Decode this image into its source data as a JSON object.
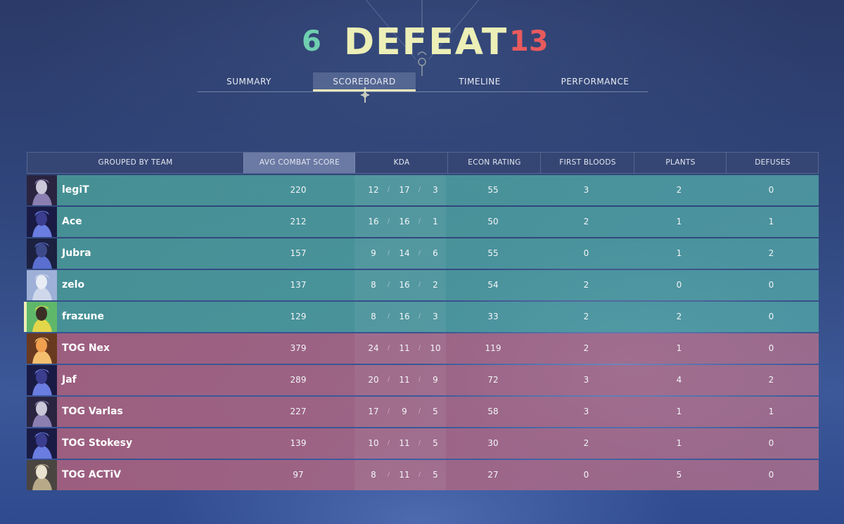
{
  "header": {
    "team_score": "6",
    "result": "DEFEAT",
    "enemy_score": "13",
    "team_color": "#6fcfb0",
    "enemy_color": "#e85a5e",
    "result_color": "#ecefb6"
  },
  "tabs": [
    {
      "label": "SUMMARY"
    },
    {
      "label": "SCOREBOARD",
      "active": true
    },
    {
      "label": "TIMELINE"
    },
    {
      "label": "PERFORMANCE"
    }
  ],
  "table": {
    "columns": [
      "GROUPED BY TEAM",
      "AVG COMBAT SCORE",
      "KDA",
      "ECON RATING",
      "FIRST BLOODS",
      "PLANTS",
      "DEFUSES"
    ],
    "sorted_column": "AVG COMBAT SCORE",
    "rows": [
      {
        "team": "ally",
        "name": "legiT",
        "acs": "220",
        "kills": "12",
        "deaths": "17",
        "assists": "3",
        "econ": "55",
        "first_bloods": "3",
        "plants": "2",
        "defuses": "0",
        "agent_icon": "agent-portrait-1"
      },
      {
        "team": "ally",
        "name": "Ace",
        "acs": "212",
        "kills": "16",
        "deaths": "16",
        "assists": "1",
        "econ": "50",
        "first_bloods": "2",
        "plants": "1",
        "defuses": "1",
        "agent_icon": "agent-portrait-2"
      },
      {
        "team": "ally",
        "name": "Jubra",
        "acs": "157",
        "kills": "9",
        "deaths": "14",
        "assists": "6",
        "econ": "55",
        "first_bloods": "0",
        "plants": "1",
        "defuses": "2",
        "agent_icon": "agent-portrait-3"
      },
      {
        "team": "ally",
        "name": "zelo",
        "acs": "137",
        "kills": "8",
        "deaths": "16",
        "assists": "2",
        "econ": "54",
        "first_bloods": "2",
        "plants": "0",
        "defuses": "0",
        "agent_icon": "agent-portrait-4"
      },
      {
        "team": "ally",
        "name": "frazune",
        "acs": "129",
        "kills": "8",
        "deaths": "16",
        "assists": "3",
        "econ": "33",
        "first_bloods": "2",
        "plants": "2",
        "defuses": "0",
        "agent_icon": "agent-portrait-5",
        "is_self": true
      },
      {
        "team": "enemy",
        "name": "TOG Nex",
        "acs": "379",
        "kills": "24",
        "deaths": "11",
        "assists": "10",
        "econ": "119",
        "first_bloods": "2",
        "plants": "1",
        "defuses": "0",
        "agent_icon": "agent-portrait-6"
      },
      {
        "team": "enemy",
        "name": "Jaf",
        "acs": "289",
        "kills": "20",
        "deaths": "11",
        "assists": "9",
        "econ": "72",
        "first_bloods": "3",
        "plants": "4",
        "defuses": "2",
        "agent_icon": "agent-portrait-7"
      },
      {
        "team": "enemy",
        "name": "TOG Varlas",
        "acs": "227",
        "kills": "17",
        "deaths": "9",
        "assists": "5",
        "econ": "58",
        "first_bloods": "3",
        "plants": "1",
        "defuses": "1",
        "agent_icon": "agent-portrait-8"
      },
      {
        "team": "enemy",
        "name": "TOG Stokesy",
        "acs": "139",
        "kills": "10",
        "deaths": "11",
        "assists": "5",
        "econ": "30",
        "first_bloods": "2",
        "plants": "1",
        "defuses": "0",
        "agent_icon": "agent-portrait-9"
      },
      {
        "team": "enemy",
        "name": "TOG ACTiV",
        "acs": "97",
        "kills": "8",
        "deaths": "11",
        "assists": "5",
        "econ": "27",
        "first_bloods": "0",
        "plants": "5",
        "defuses": "0",
        "agent_icon": "agent-portrait-10"
      }
    ]
  }
}
